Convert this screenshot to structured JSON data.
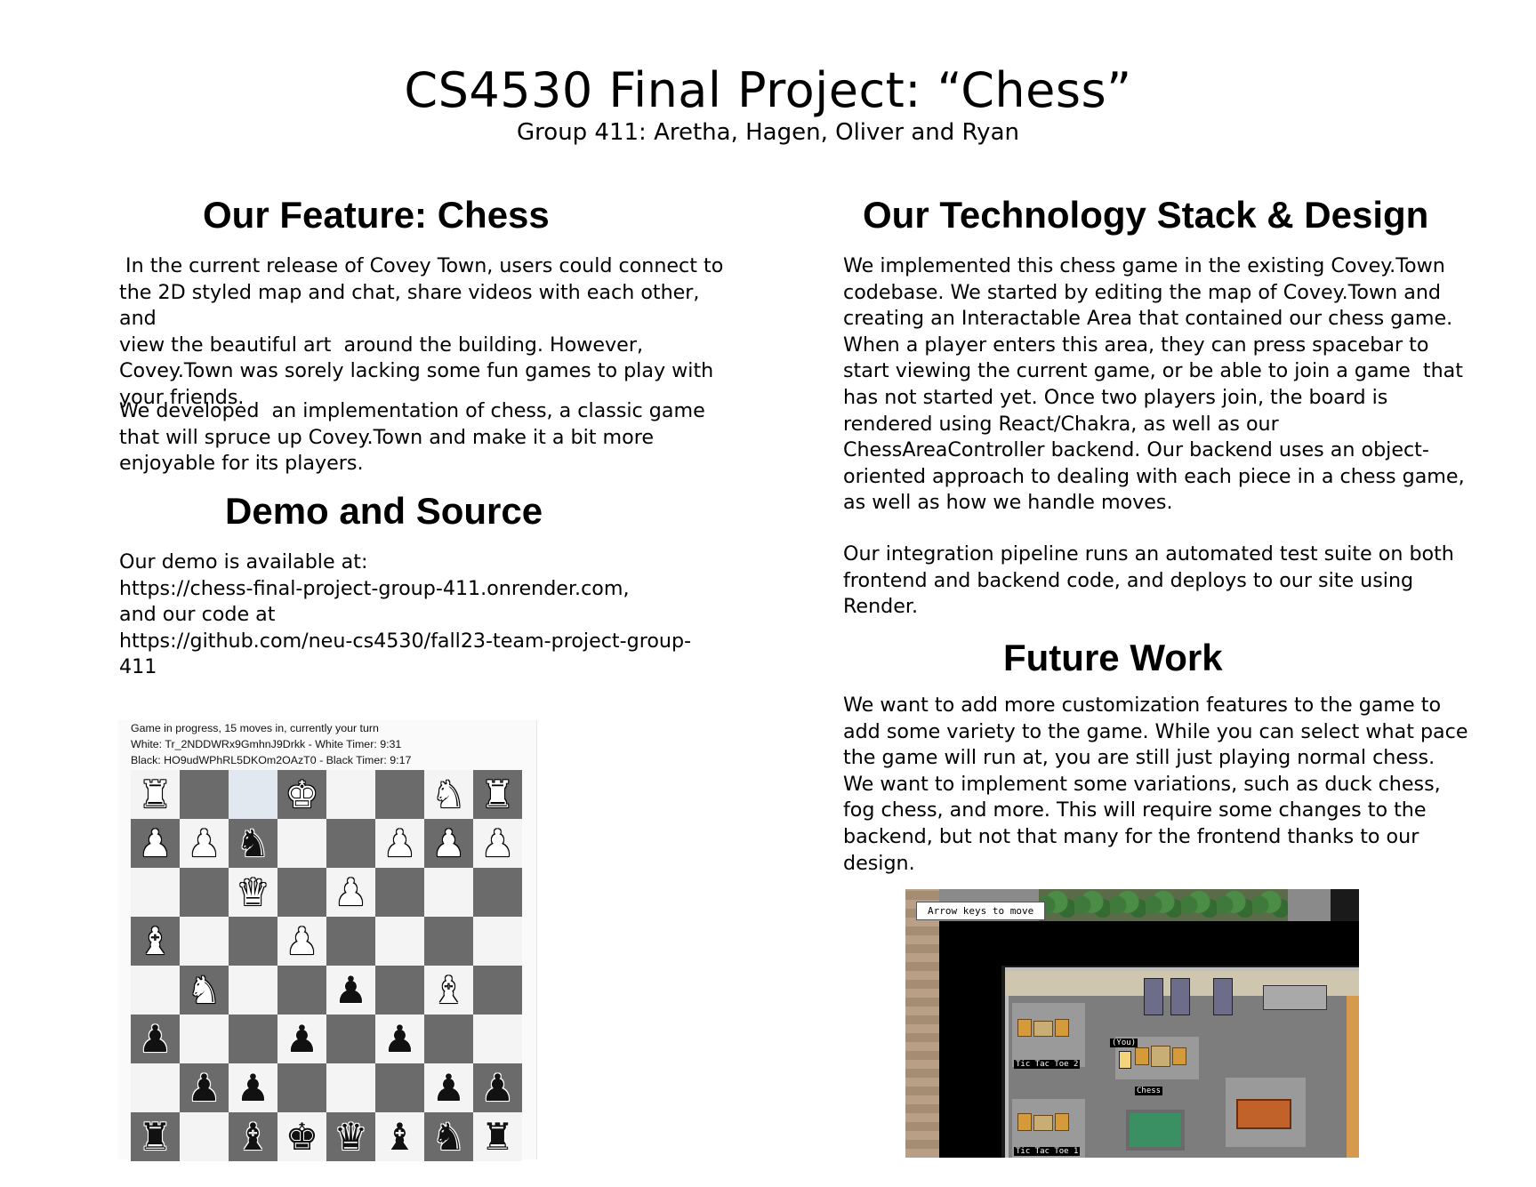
{
  "header": {
    "title": "CS4530 Final Project: “Chess”",
    "subtitle": "Group 411: Aretha, Hagen, Oliver and Ryan"
  },
  "feature": {
    "heading": "Our Feature: Chess",
    "p1_lines": [
      " In the current release of Covey Town, users could connect to",
      "the 2D styled map and chat, share videos with each other, and",
      "view the beautiful art  around the building. However,",
      "Covey.Town was sorely lacking some fun games to play with",
      "your friends."
    ],
    "p2_lines": [
      "We developed  an implementation of chess, a classic game",
      "that will spruce up Covey.Town and make it a bit more",
      "enjoyable for its players."
    ]
  },
  "demo": {
    "heading": "Demo and Source",
    "lines": [
      "Our demo is available at:",
      "https://chess-final-project-group-411.onrender.com,",
      "and our code at",
      "https://github.com/neu-cs4530/fall23-team-project-group-",
      "411"
    ]
  },
  "chess_screenshot": {
    "status": "Game in progress, 15 moves in, currently your turn",
    "white": "White: Tr_2NDDWRx9GmhnJ9Drkk - White Timer: 9:31",
    "black": "Black: HO9udWPhRL5DKOm2OAzT0 - Black Timer: 9:17",
    "board": [
      [
        "wR",
        "",
        "",
        "wK",
        "",
        "",
        "wN",
        "wR"
      ],
      [
        "wP",
        "wP",
        "bN",
        "",
        "",
        "wP",
        "wP",
        "wP"
      ],
      [
        "",
        "",
        "wQ",
        "",
        "wP",
        "",
        "",
        ""
      ],
      [
        "wB",
        "",
        "",
        "wP",
        "",
        "",
        "",
        ""
      ],
      [
        "",
        "wN",
        "",
        "",
        "bP",
        "",
        "wB",
        ""
      ],
      [
        "bP",
        "",
        "",
        "bP",
        "",
        "bP",
        "",
        ""
      ],
      [
        "",
        "bP",
        "bP",
        "",
        "",
        "",
        "bP",
        "bP"
      ],
      [
        "bR",
        "",
        "bB",
        "bK",
        "bQ",
        "bB",
        "bN",
        "bR"
      ]
    ],
    "highlight": [
      0,
      2
    ],
    "glyphs": {
      "K": "♚",
      "Q": "♛",
      "R": "♜",
      "B": "♝",
      "N": "♞",
      "P": "♟"
    }
  },
  "tech": {
    "heading": "Our Technology Stack & Design",
    "p1_lines": [
      "We implemented this chess game in the existing Covey.Town",
      "codebase. We started by editing the map of Covey.Town and",
      "creating an Interactable Area that contained our chess game.",
      "When a player enters this area, they can press spacebar to",
      "start viewing the current game, or be able to join a game  that",
      "has not started yet. Once two players join, the board is",
      "rendered using React/Chakra, as well as our",
      "ChessAreaController backend. Our backend uses an object-",
      "oriented approach to dealing with each piece in a chess game,",
      "as well as how we handle moves."
    ],
    "p2_lines": [
      "Our integration pipeline runs an automated test suite on both",
      "frontend and backend code, and deploys to our site using",
      "Render."
    ]
  },
  "future": {
    "heading": "Future Work",
    "lines": [
      "We want to add more customization features to the game to",
      "add some variety to the game. While you can select what pace",
      "the game will run at, you are still just playing normal chess.",
      "We want to implement some variations, such as duck chess,",
      "fog chess, and more. This will require some changes to the",
      "backend, but not that many for the frontend thanks to our",
      "design."
    ]
  },
  "map_screenshot": {
    "tip": "Arrow keys to move",
    "labels": [
      "Tic Tac Toe 2",
      "(You)",
      "Chess",
      "Tic Tac Toe 1"
    ]
  }
}
